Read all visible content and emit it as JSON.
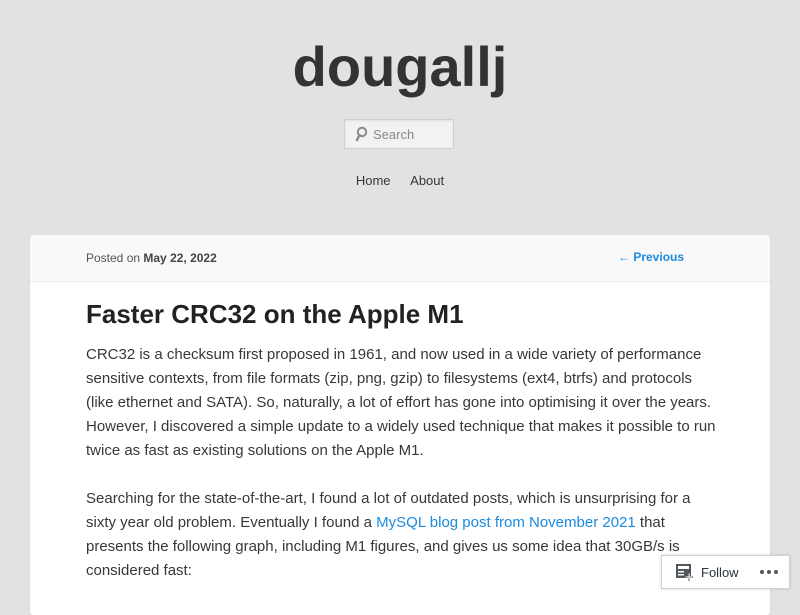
{
  "site": {
    "title": "dougallj"
  },
  "search": {
    "placeholder": "Search"
  },
  "nav": {
    "items": [
      {
        "label": "Home"
      },
      {
        "label": "About"
      }
    ]
  },
  "post": {
    "posted_prefix": "Posted on",
    "date": "May 22, 2022",
    "previous_label": "← Previous",
    "title": "Faster CRC32 on the Apple M1",
    "paragraph1": "CRC32 is a checksum first proposed in 1961, and now used in a wide variety of performance sensitive contexts, from file formats (zip, png, gzip) to filesystems (ext4, btrfs) and protocols (like ethernet and SATA). So, naturally, a lot of effort has gone into optimising it over the years. However, I discovered a simple update to a widely used technique that makes it possible to run twice as fast as existing solutions on the Apple M1.",
    "paragraph2_before": "Searching for the state-of-the-art, I found a lot of outdated posts, which is unsurprising for a sixty year old problem. Eventually I found a ",
    "paragraph2_link": "MySQL blog post from November 2021",
    "paragraph2_after": " that presents the following graph, including M1 figures, and gives us some idea that 30GB/s is considered fast:"
  },
  "follow_widget": {
    "follow_label": "Follow",
    "follow_icon": "reader-follow-icon",
    "more_icon": "ellipsis-icon"
  },
  "colors": {
    "background": "#e2e2e2",
    "link": "#1b8be0",
    "card": "#ffffff"
  }
}
